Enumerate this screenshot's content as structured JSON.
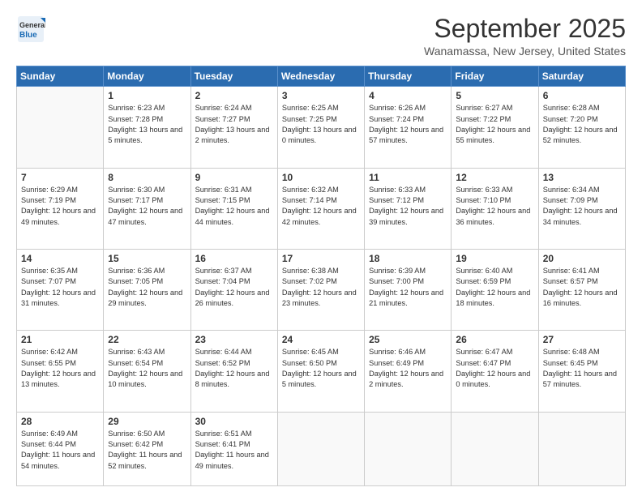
{
  "header": {
    "logo_line1": "General",
    "logo_line2": "Blue",
    "month": "September 2025",
    "location": "Wanamassa, New Jersey, United States"
  },
  "weekdays": [
    "Sunday",
    "Monday",
    "Tuesday",
    "Wednesday",
    "Thursday",
    "Friday",
    "Saturday"
  ],
  "weeks": [
    [
      {
        "day": "",
        "sunrise": "",
        "sunset": "",
        "daylight": ""
      },
      {
        "day": "1",
        "sunrise": "Sunrise: 6:23 AM",
        "sunset": "Sunset: 7:28 PM",
        "daylight": "Daylight: 13 hours and 5 minutes."
      },
      {
        "day": "2",
        "sunrise": "Sunrise: 6:24 AM",
        "sunset": "Sunset: 7:27 PM",
        "daylight": "Daylight: 13 hours and 2 minutes."
      },
      {
        "day": "3",
        "sunrise": "Sunrise: 6:25 AM",
        "sunset": "Sunset: 7:25 PM",
        "daylight": "Daylight: 13 hours and 0 minutes."
      },
      {
        "day": "4",
        "sunrise": "Sunrise: 6:26 AM",
        "sunset": "Sunset: 7:24 PM",
        "daylight": "Daylight: 12 hours and 57 minutes."
      },
      {
        "day": "5",
        "sunrise": "Sunrise: 6:27 AM",
        "sunset": "Sunset: 7:22 PM",
        "daylight": "Daylight: 12 hours and 55 minutes."
      },
      {
        "day": "6",
        "sunrise": "Sunrise: 6:28 AM",
        "sunset": "Sunset: 7:20 PM",
        "daylight": "Daylight: 12 hours and 52 minutes."
      }
    ],
    [
      {
        "day": "7",
        "sunrise": "Sunrise: 6:29 AM",
        "sunset": "Sunset: 7:19 PM",
        "daylight": "Daylight: 12 hours and 49 minutes."
      },
      {
        "day": "8",
        "sunrise": "Sunrise: 6:30 AM",
        "sunset": "Sunset: 7:17 PM",
        "daylight": "Daylight: 12 hours and 47 minutes."
      },
      {
        "day": "9",
        "sunrise": "Sunrise: 6:31 AM",
        "sunset": "Sunset: 7:15 PM",
        "daylight": "Daylight: 12 hours and 44 minutes."
      },
      {
        "day": "10",
        "sunrise": "Sunrise: 6:32 AM",
        "sunset": "Sunset: 7:14 PM",
        "daylight": "Daylight: 12 hours and 42 minutes."
      },
      {
        "day": "11",
        "sunrise": "Sunrise: 6:33 AM",
        "sunset": "Sunset: 7:12 PM",
        "daylight": "Daylight: 12 hours and 39 minutes."
      },
      {
        "day": "12",
        "sunrise": "Sunrise: 6:33 AM",
        "sunset": "Sunset: 7:10 PM",
        "daylight": "Daylight: 12 hours and 36 minutes."
      },
      {
        "day": "13",
        "sunrise": "Sunrise: 6:34 AM",
        "sunset": "Sunset: 7:09 PM",
        "daylight": "Daylight: 12 hours and 34 minutes."
      }
    ],
    [
      {
        "day": "14",
        "sunrise": "Sunrise: 6:35 AM",
        "sunset": "Sunset: 7:07 PM",
        "daylight": "Daylight: 12 hours and 31 minutes."
      },
      {
        "day": "15",
        "sunrise": "Sunrise: 6:36 AM",
        "sunset": "Sunset: 7:05 PM",
        "daylight": "Daylight: 12 hours and 29 minutes."
      },
      {
        "day": "16",
        "sunrise": "Sunrise: 6:37 AM",
        "sunset": "Sunset: 7:04 PM",
        "daylight": "Daylight: 12 hours and 26 minutes."
      },
      {
        "day": "17",
        "sunrise": "Sunrise: 6:38 AM",
        "sunset": "Sunset: 7:02 PM",
        "daylight": "Daylight: 12 hours and 23 minutes."
      },
      {
        "day": "18",
        "sunrise": "Sunrise: 6:39 AM",
        "sunset": "Sunset: 7:00 PM",
        "daylight": "Daylight: 12 hours and 21 minutes."
      },
      {
        "day": "19",
        "sunrise": "Sunrise: 6:40 AM",
        "sunset": "Sunset: 6:59 PM",
        "daylight": "Daylight: 12 hours and 18 minutes."
      },
      {
        "day": "20",
        "sunrise": "Sunrise: 6:41 AM",
        "sunset": "Sunset: 6:57 PM",
        "daylight": "Daylight: 12 hours and 16 minutes."
      }
    ],
    [
      {
        "day": "21",
        "sunrise": "Sunrise: 6:42 AM",
        "sunset": "Sunset: 6:55 PM",
        "daylight": "Daylight: 12 hours and 13 minutes."
      },
      {
        "day": "22",
        "sunrise": "Sunrise: 6:43 AM",
        "sunset": "Sunset: 6:54 PM",
        "daylight": "Daylight: 12 hours and 10 minutes."
      },
      {
        "day": "23",
        "sunrise": "Sunrise: 6:44 AM",
        "sunset": "Sunset: 6:52 PM",
        "daylight": "Daylight: 12 hours and 8 minutes."
      },
      {
        "day": "24",
        "sunrise": "Sunrise: 6:45 AM",
        "sunset": "Sunset: 6:50 PM",
        "daylight": "Daylight: 12 hours and 5 minutes."
      },
      {
        "day": "25",
        "sunrise": "Sunrise: 6:46 AM",
        "sunset": "Sunset: 6:49 PM",
        "daylight": "Daylight: 12 hours and 2 minutes."
      },
      {
        "day": "26",
        "sunrise": "Sunrise: 6:47 AM",
        "sunset": "Sunset: 6:47 PM",
        "daylight": "Daylight: 12 hours and 0 minutes."
      },
      {
        "day": "27",
        "sunrise": "Sunrise: 6:48 AM",
        "sunset": "Sunset: 6:45 PM",
        "daylight": "Daylight: 11 hours and 57 minutes."
      }
    ],
    [
      {
        "day": "28",
        "sunrise": "Sunrise: 6:49 AM",
        "sunset": "Sunset: 6:44 PM",
        "daylight": "Daylight: 11 hours and 54 minutes."
      },
      {
        "day": "29",
        "sunrise": "Sunrise: 6:50 AM",
        "sunset": "Sunset: 6:42 PM",
        "daylight": "Daylight: 11 hours and 52 minutes."
      },
      {
        "day": "30",
        "sunrise": "Sunrise: 6:51 AM",
        "sunset": "Sunset: 6:41 PM",
        "daylight": "Daylight: 11 hours and 49 minutes."
      },
      {
        "day": "",
        "sunrise": "",
        "sunset": "",
        "daylight": ""
      },
      {
        "day": "",
        "sunrise": "",
        "sunset": "",
        "daylight": ""
      },
      {
        "day": "",
        "sunrise": "",
        "sunset": "",
        "daylight": ""
      },
      {
        "day": "",
        "sunrise": "",
        "sunset": "",
        "daylight": ""
      }
    ]
  ]
}
